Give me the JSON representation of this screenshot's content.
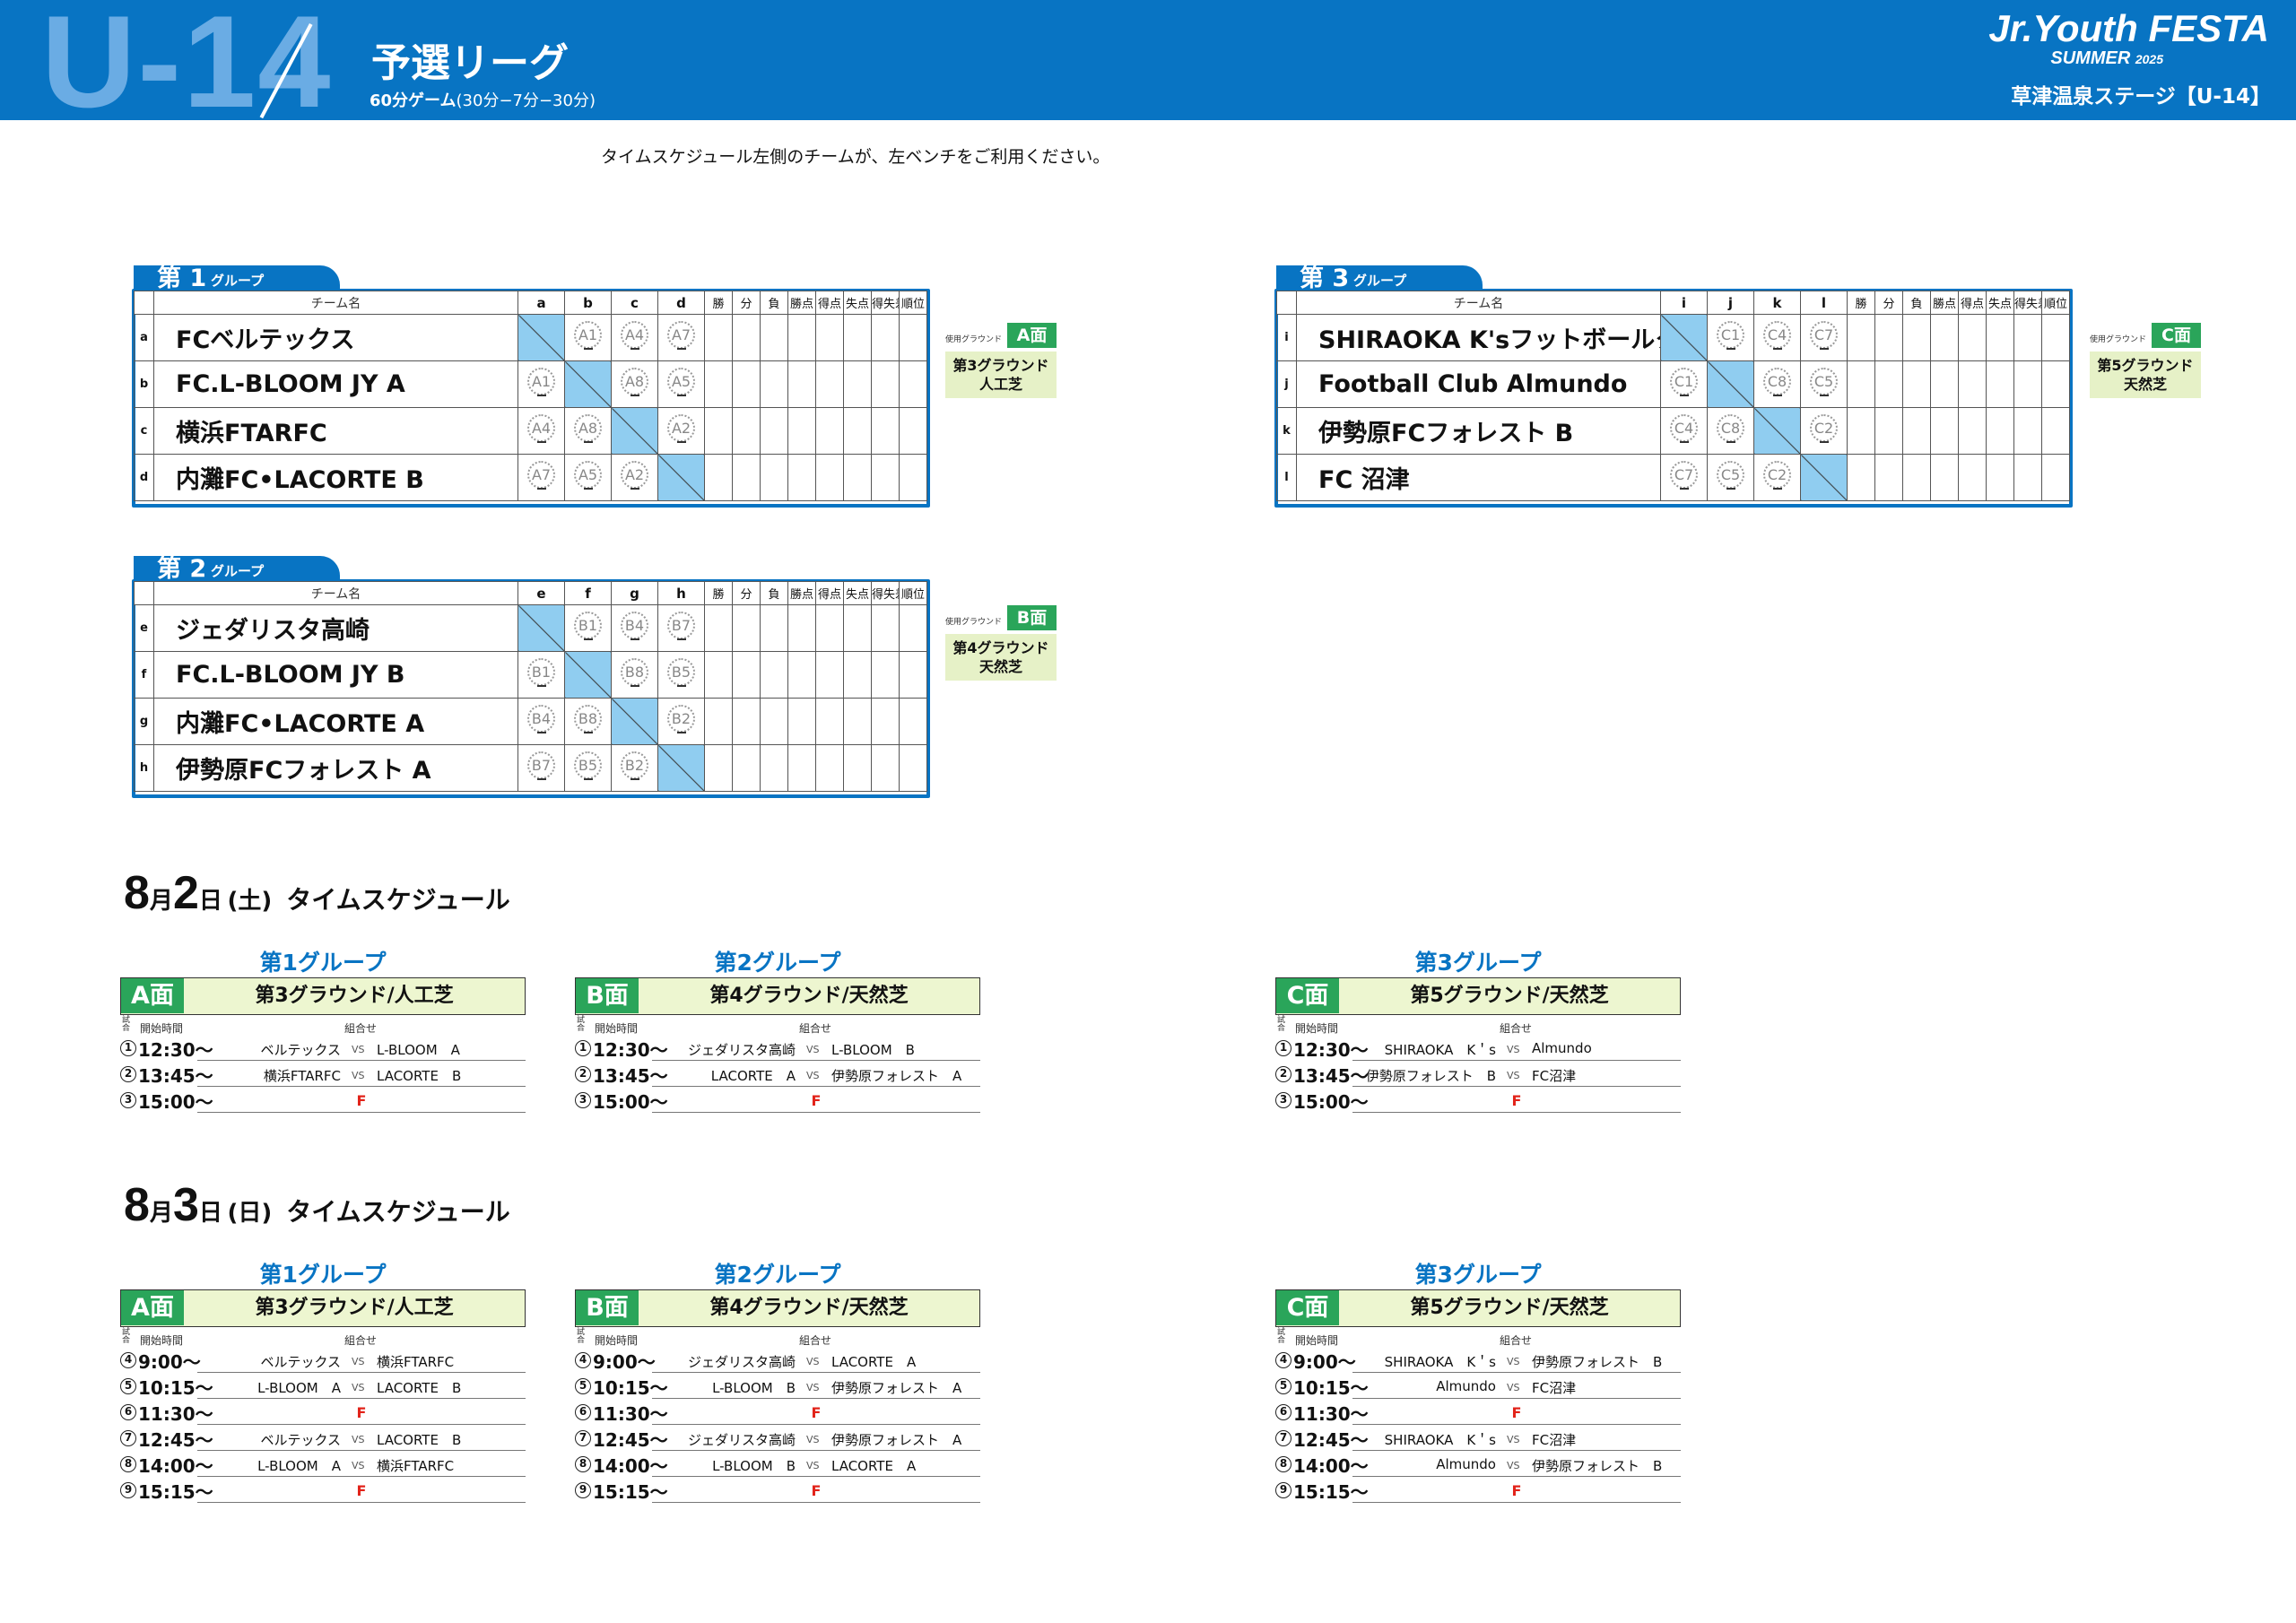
{
  "header": {
    "age": "U-14",
    "title": "予選リーグ",
    "format_bold": "60分ゲーム",
    "format_detail": "(30分−7分−30分)",
    "logo_main": "Jr.Youth FESTA",
    "logo_sub": "SUMMER",
    "logo_year": "2025",
    "venue": "草津温泉ステージ【U-14】",
    "bg_color": "#0874c3"
  },
  "note": "タイムスケジュール左側のチームが、左ベンチをご利用ください。",
  "table_headers": {
    "team_name": "チーム名",
    "stats": [
      "勝",
      "分",
      "負",
      "勝点",
      "得点",
      "失点",
      "得失差",
      "順位"
    ]
  },
  "groups": [
    {
      "tab_num": "第 1",
      "tab_sub": "グループ",
      "cols": [
        "a",
        "b",
        "c",
        "d"
      ],
      "rows": [
        {
          "label": "a",
          "team": "FCベルテックス",
          "cells": [
            "",
            "A1",
            "A4",
            "A7"
          ]
        },
        {
          "label": "b",
          "team": "FC.L-BLOOM JY A",
          "cells": [
            "A1",
            "",
            "A8",
            "A5"
          ]
        },
        {
          "label": "c",
          "team": "横浜FTARFC",
          "cells": [
            "A4",
            "A8",
            "",
            "A2"
          ]
        },
        {
          "label": "d",
          "team": "内灘FC•LACORTE B",
          "cells": [
            "A7",
            "A5",
            "A2",
            ""
          ]
        }
      ],
      "ground_label": "使用グラウンド",
      "pitch": "A面",
      "ground_line1": "第3グラウンド",
      "ground_line2": "人工芝"
    },
    {
      "tab_num": "第 2",
      "tab_sub": "グループ",
      "cols": [
        "e",
        "f",
        "g",
        "h"
      ],
      "rows": [
        {
          "label": "e",
          "team": "ジェダリスタ高崎",
          "cells": [
            "",
            "B1",
            "B4",
            "B7"
          ]
        },
        {
          "label": "f",
          "team": "FC.L-BLOOM JY B",
          "cells": [
            "B1",
            "",
            "B8",
            "B5"
          ]
        },
        {
          "label": "g",
          "team": "内灘FC•LACORTE A",
          "cells": [
            "B4",
            "B8",
            "",
            "B2"
          ]
        },
        {
          "label": "h",
          "team": "伊勢原FCフォレスト A",
          "cells": [
            "B7",
            "B5",
            "B2",
            ""
          ]
        }
      ],
      "ground_label": "使用グラウンド",
      "pitch": "B面",
      "ground_line1": "第4グラウンド",
      "ground_line2": "天然芝"
    },
    {
      "tab_num": "第 3",
      "tab_sub": "グループ",
      "cols": [
        "i",
        "j",
        "k",
        "l"
      ],
      "rows": [
        {
          "label": "i",
          "team": "SHIRAOKA K'sフットボールクラブ",
          "cells": [
            "",
            "C1",
            "C4",
            "C7"
          ]
        },
        {
          "label": "j",
          "team": "Football Club Almundo",
          "cells": [
            "C1",
            "",
            "C8",
            "C5"
          ]
        },
        {
          "label": "k",
          "team": "伊勢原FCフォレスト B",
          "cells": [
            "C4",
            "C8",
            "",
            "C2"
          ]
        },
        {
          "label": "l",
          "team": "FC 沼津",
          "cells": [
            "C7",
            "C5",
            "C2",
            ""
          ]
        }
      ],
      "ground_label": "使用グラウンド",
      "pitch": "C面",
      "ground_line1": "第5グラウンド",
      "ground_line2": "天然芝"
    }
  ],
  "schedule_columns": {
    "no": "試合",
    "time": "開始時間",
    "match": "組合せ"
  },
  "days": [
    {
      "month": "8",
      "month_unit": "月",
      "day": "2",
      "day_unit": "日",
      "weekday": "(土)",
      "label": "タイムスケジュール",
      "schedules": [
        {
          "group": "第1グループ",
          "pitch": "A面",
          "ground": "第3グラウンド/人工芝",
          "rows": [
            {
              "no": "1",
              "time": "12:30〜",
              "home": "ベルテックス",
              "vs": "VS",
              "away": "L-BLOOM　A",
              "free": ""
            },
            {
              "no": "2",
              "time": "13:45〜",
              "home": "横浜FTARFC",
              "vs": "VS",
              "away": "LACORTE　B",
              "free": ""
            },
            {
              "no": "3",
              "time": "15:00〜",
              "home": "",
              "vs": "",
              "away": "",
              "free": "F"
            }
          ]
        },
        {
          "group": "第2グループ",
          "pitch": "B面",
          "ground": "第4グラウンド/天然芝",
          "rows": [
            {
              "no": "1",
              "time": "12:30〜",
              "home": "ジェダリスタ高崎",
              "vs": "VS",
              "away": "L-BLOOM　B",
              "free": ""
            },
            {
              "no": "2",
              "time": "13:45〜",
              "home": "LACORTE　A",
              "vs": "VS",
              "away": "伊勢原フォレスト　A",
              "free": ""
            },
            {
              "no": "3",
              "time": "15:00〜",
              "home": "",
              "vs": "",
              "away": "",
              "free": "F"
            }
          ]
        },
        {
          "group": "第3グループ",
          "pitch": "C面",
          "ground": "第5グラウンド/天然芝",
          "rows": [
            {
              "no": "1",
              "time": "12:30〜",
              "home": "SHIRAOKA　K＇s",
              "vs": "VS",
              "away": "Almundo",
              "free": ""
            },
            {
              "no": "2",
              "time": "13:45〜",
              "home": "伊勢原フォレスト　B",
              "vs": "VS",
              "away": "FC沼津",
              "free": ""
            },
            {
              "no": "3",
              "time": "15:00〜",
              "home": "",
              "vs": "",
              "away": "",
              "free": "F"
            }
          ]
        }
      ]
    },
    {
      "month": "8",
      "month_unit": "月",
      "day": "3",
      "day_unit": "日",
      "weekday": "(日)",
      "label": "タイムスケジュール",
      "schedules": [
        {
          "group": "第1グループ",
          "pitch": "A面",
          "ground": "第3グラウンド/人工芝",
          "rows": [
            {
              "no": "4",
              "time": "9:00〜",
              "home": "ベルテックス",
              "vs": "VS",
              "away": "横浜FTARFC",
              "free": ""
            },
            {
              "no": "5",
              "time": "10:15〜",
              "home": "L-BLOOM　A",
              "vs": "VS",
              "away": "LACORTE　B",
              "free": ""
            },
            {
              "no": "6",
              "time": "11:30〜",
              "home": "",
              "vs": "",
              "away": "",
              "free": "F"
            },
            {
              "no": "7",
              "time": "12:45〜",
              "home": "ベルテックス",
              "vs": "VS",
              "away": "LACORTE　B",
              "free": ""
            },
            {
              "no": "8",
              "time": "14:00〜",
              "home": "L-BLOOM　A",
              "vs": "VS",
              "away": "横浜FTARFC",
              "free": ""
            },
            {
              "no": "9",
              "time": "15:15〜",
              "home": "",
              "vs": "",
              "away": "",
              "free": "F"
            }
          ]
        },
        {
          "group": "第2グループ",
          "pitch": "B面",
          "ground": "第4グラウンド/天然芝",
          "rows": [
            {
              "no": "4",
              "time": "9:00〜",
              "home": "ジェダリスタ高崎",
              "vs": "VS",
              "away": "LACORTE　A",
              "free": ""
            },
            {
              "no": "5",
              "time": "10:15〜",
              "home": "L-BLOOM　B",
              "vs": "VS",
              "away": "伊勢原フォレスト　A",
              "free": ""
            },
            {
              "no": "6",
              "time": "11:30〜",
              "home": "",
              "vs": "",
              "away": "",
              "free": "F"
            },
            {
              "no": "7",
              "time": "12:45〜",
              "home": "ジェダリスタ高崎",
              "vs": "VS",
              "away": "伊勢原フォレスト　A",
              "free": ""
            },
            {
              "no": "8",
              "time": "14:00〜",
              "home": "L-BLOOM　B",
              "vs": "VS",
              "away": "LACORTE　A",
              "free": ""
            },
            {
              "no": "9",
              "time": "15:15〜",
              "home": "",
              "vs": "",
              "away": "",
              "free": "F"
            }
          ]
        },
        {
          "group": "第3グループ",
          "pitch": "C面",
          "ground": "第5グラウンド/天然芝",
          "rows": [
            {
              "no": "4",
              "time": "9:00〜",
              "home": "SHIRAOKA　K＇s",
              "vs": "VS",
              "away": "伊勢原フォレスト　B",
              "free": ""
            },
            {
              "no": "5",
              "time": "10:15〜",
              "home": "Almundo",
              "vs": "VS",
              "away": "FC沼津",
              "free": ""
            },
            {
              "no": "6",
              "time": "11:30〜",
              "home": "",
              "vs": "",
              "away": "",
              "free": "F"
            },
            {
              "no": "7",
              "time": "12:45〜",
              "home": "SHIRAOKA　K＇s",
              "vs": "VS",
              "away": "FC沼津",
              "free": ""
            },
            {
              "no": "8",
              "time": "14:00〜",
              "home": "Almundo",
              "vs": "VS",
              "away": "伊勢原フォレスト　B",
              "free": ""
            },
            {
              "no": "9",
              "time": "15:15〜",
              "home": "",
              "vs": "",
              "away": "",
              "free": "F"
            }
          ]
        }
      ]
    }
  ]
}
